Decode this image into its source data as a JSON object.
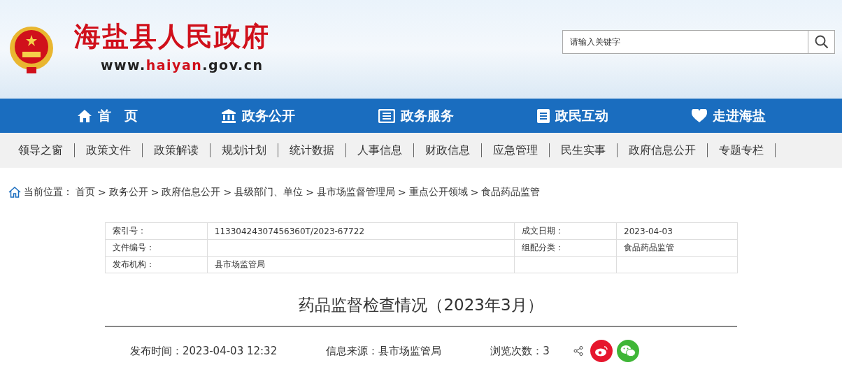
{
  "header": {
    "site_title": "海盐县人民政府",
    "site_url": [
      {
        "text": "www.",
        "highlight": false
      },
      {
        "text": "haiyan",
        "highlight": true
      },
      {
        "text": ".gov.cn",
        "highlight": false
      }
    ],
    "search": {
      "placeholder": "请输入关键字"
    }
  },
  "main_nav": [
    {
      "label": "首　页",
      "kind": "home"
    },
    {
      "label": "政务公开",
      "kind": "building"
    },
    {
      "label": "政务服务",
      "kind": "list"
    },
    {
      "label": "政民互动",
      "kind": "doc"
    },
    {
      "label": "走进海盐",
      "kind": "heart"
    }
  ],
  "sub_nav": [
    "领导之窗",
    "政策文件",
    "政策解读",
    "规划计划",
    "统计数据",
    "人事信息",
    "财政信息",
    "应急管理",
    "民生实事",
    "政府信息公开",
    "专题专栏"
  ],
  "breadcrumb": {
    "label": "当前位置：",
    "separator": ">",
    "items": [
      "首页",
      "政务公开",
      "政府信息公开",
      "县级部门、单位",
      "县市场监督管理局",
      "重点公开领域",
      "食品药品监管"
    ]
  },
  "info_table": {
    "rows": [
      [
        "索引号：",
        "11330424307456360T/2023-67722",
        "成文日期：",
        "2023-04-03"
      ],
      [
        "文件编号：",
        "",
        "组配分类：",
        "食品药品监管"
      ],
      [
        "发布机构：",
        "县市场监管局",
        "",
        ""
      ]
    ]
  },
  "article": {
    "title": "药品监督检查情况（2023年3月）",
    "publish_time": "发布时间：2023-04-03 12:32",
    "source": "信息来源：县市场监管局",
    "views": "浏览次数：3"
  }
}
